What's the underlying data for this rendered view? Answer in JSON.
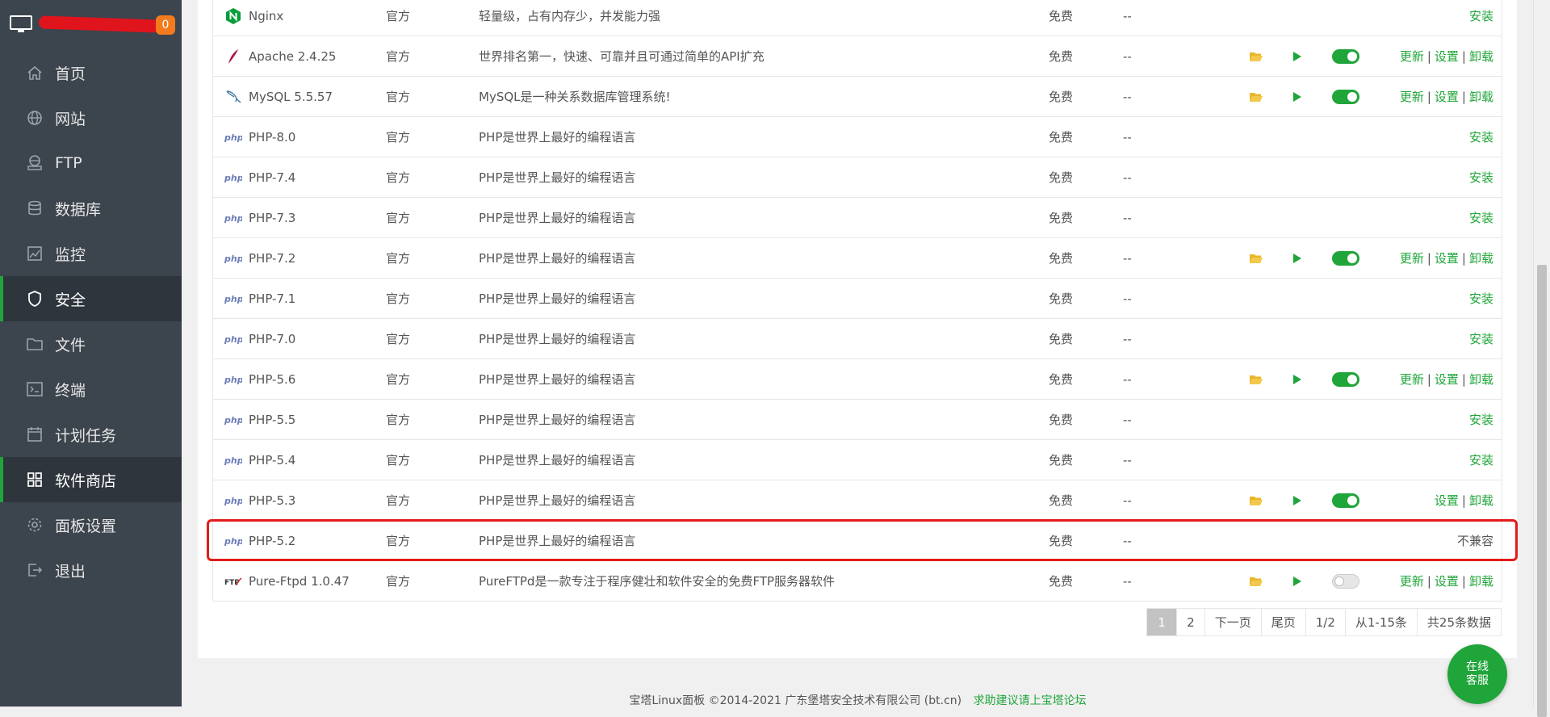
{
  "sidebar": {
    "badge": "0",
    "items": [
      {
        "label": "首页",
        "icon": "home-icon"
      },
      {
        "label": "网站",
        "icon": "globe-icon"
      },
      {
        "label": "FTP",
        "icon": "ftp-server-icon"
      },
      {
        "label": "数据库",
        "icon": "database-icon"
      },
      {
        "label": "监控",
        "icon": "chart-icon"
      },
      {
        "label": "安全",
        "icon": "shield-icon"
      },
      {
        "label": "文件",
        "icon": "folder-icon"
      },
      {
        "label": "终端",
        "icon": "terminal-icon"
      },
      {
        "label": "计划任务",
        "icon": "calendar-icon"
      },
      {
        "label": "软件商店",
        "icon": "grid-icon"
      },
      {
        "label": "面板设置",
        "icon": "gear-icon"
      },
      {
        "label": "退出",
        "icon": "logout-icon"
      }
    ]
  },
  "table": {
    "rows": [
      {
        "name": "Nginx",
        "icon": "nginx-icon",
        "type": "官方",
        "desc": "轻量级，占有内存少，并发能力强",
        "price": "免费",
        "expire": "--",
        "folder": false,
        "play": false,
        "toggle": null,
        "ops": [
          "安装"
        ]
      },
      {
        "name": "Apache 2.4.25",
        "icon": "apache-feather-icon",
        "type": "官方",
        "desc": "世界排名第一，快速、可靠并且可通过简单的API扩充",
        "price": "免费",
        "expire": "--",
        "folder": true,
        "play": true,
        "toggle": "on",
        "ops": [
          "更新",
          "设置",
          "卸载"
        ]
      },
      {
        "name": "MySQL 5.5.57",
        "icon": "mysql-dolphin-icon",
        "type": "官方",
        "desc": "MySQL是一种关系数据库管理系统!",
        "price": "免费",
        "expire": "--",
        "folder": true,
        "play": true,
        "toggle": "on",
        "ops": [
          "更新",
          "设置",
          "卸载"
        ]
      },
      {
        "name": "PHP-8.0",
        "icon": "php-icon",
        "type": "官方",
        "desc": "PHP是世界上最好的编程语言",
        "price": "免费",
        "expire": "--",
        "folder": false,
        "play": false,
        "toggle": null,
        "ops": [
          "安装"
        ]
      },
      {
        "name": "PHP-7.4",
        "icon": "php-icon",
        "type": "官方",
        "desc": "PHP是世界上最好的编程语言",
        "price": "免费",
        "expire": "--",
        "folder": false,
        "play": false,
        "toggle": null,
        "ops": [
          "安装"
        ]
      },
      {
        "name": "PHP-7.3",
        "icon": "php-icon",
        "type": "官方",
        "desc": "PHP是世界上最好的编程语言",
        "price": "免费",
        "expire": "--",
        "folder": false,
        "play": false,
        "toggle": null,
        "ops": [
          "安装"
        ]
      },
      {
        "name": "PHP-7.2",
        "icon": "php-icon",
        "type": "官方",
        "desc": "PHP是世界上最好的编程语言",
        "price": "免费",
        "expire": "--",
        "folder": true,
        "play": true,
        "toggle": "on",
        "ops": [
          "更新",
          "设置",
          "卸载"
        ]
      },
      {
        "name": "PHP-7.1",
        "icon": "php-icon",
        "type": "官方",
        "desc": "PHP是世界上最好的编程语言",
        "price": "免费",
        "expire": "--",
        "folder": false,
        "play": false,
        "toggle": null,
        "ops": [
          "安装"
        ]
      },
      {
        "name": "PHP-7.0",
        "icon": "php-icon",
        "type": "官方",
        "desc": "PHP是世界上最好的编程语言",
        "price": "免费",
        "expire": "--",
        "folder": false,
        "play": false,
        "toggle": null,
        "ops": [
          "安装"
        ]
      },
      {
        "name": "PHP-5.6",
        "icon": "php-icon",
        "type": "官方",
        "desc": "PHP是世界上最好的编程语言",
        "price": "免费",
        "expire": "--",
        "folder": true,
        "play": true,
        "toggle": "on",
        "ops": [
          "更新",
          "设置",
          "卸载"
        ]
      },
      {
        "name": "PHP-5.5",
        "icon": "php-icon",
        "type": "官方",
        "desc": "PHP是世界上最好的编程语言",
        "price": "免费",
        "expire": "--",
        "folder": false,
        "play": false,
        "toggle": null,
        "ops": [
          "安装"
        ]
      },
      {
        "name": "PHP-5.4",
        "icon": "php-icon",
        "type": "官方",
        "desc": "PHP是世界上最好的编程语言",
        "price": "免费",
        "expire": "--",
        "folder": false,
        "play": false,
        "toggle": null,
        "ops": [
          "安装"
        ]
      },
      {
        "name": "PHP-5.3",
        "icon": "php-icon",
        "type": "官方",
        "desc": "PHP是世界上最好的编程语言",
        "price": "免费",
        "expire": "--",
        "folder": true,
        "play": true,
        "toggle": "on",
        "ops": [
          "设置",
          "卸载"
        ]
      },
      {
        "name": "PHP-5.2",
        "icon": "php-icon",
        "type": "官方",
        "desc": "PHP是世界上最好的编程语言",
        "price": "免费",
        "expire": "--",
        "folder": false,
        "play": false,
        "toggle": null,
        "ops": [],
        "status": "不兼容"
      },
      {
        "name": "Pure-Ftpd 1.0.47",
        "icon": "ftpd-icon",
        "type": "官方",
        "desc": "PureFTPd是一款专注于程序健壮和软件安全的免费FTP服务器软件",
        "price": "免费",
        "expire": "--",
        "folder": true,
        "play": true,
        "toggle": "off",
        "ops": [
          "更新",
          "设置",
          "卸载"
        ]
      }
    ]
  },
  "pager": {
    "current": "1",
    "page2": "2",
    "next": "下一页",
    "last": "尾页",
    "pages": "1/2",
    "range": "从1-15条",
    "total": "共25条数据"
  },
  "footer": {
    "copyright": "宝塔Linux面板 ©2014-2021 广东堡塔安全技术有限公司 (bt.cn)",
    "link": "求助建议请上宝塔论坛"
  },
  "service": {
    "line1": "在线",
    "line2": "客服"
  },
  "colors": {
    "sidebar_bg": "#3c444d",
    "accent": "#20a53a",
    "highlight": "#e31b1b",
    "badge": "#f37b1d"
  }
}
